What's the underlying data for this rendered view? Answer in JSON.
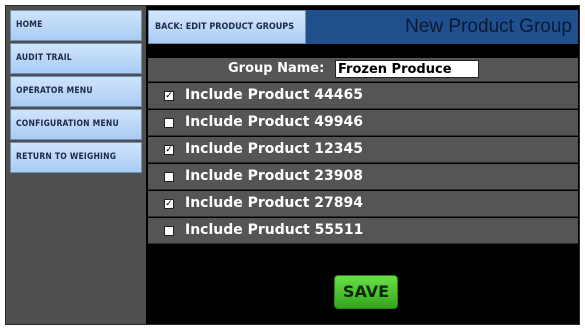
{
  "sidebar": {
    "items": [
      {
        "label": "HOME"
      },
      {
        "label": "AUDIT TRAIL"
      },
      {
        "label": "OPERATOR MENU"
      },
      {
        "label": "CONFIGURATION MENU"
      },
      {
        "label": "RETURN TO WEIGHING"
      }
    ]
  },
  "header": {
    "back_label": "BACK: EDIT PRODUCT GROUPS",
    "title": "New Product Group"
  },
  "group": {
    "label": "Group Name:",
    "value": "Frozen Produce"
  },
  "products": [
    {
      "label": "Include Product 44465",
      "checked": true,
      "mark": "✓"
    },
    {
      "label": "Include Product 49946",
      "checked": false,
      "mark": ""
    },
    {
      "label": "Include Product 12345",
      "checked": true,
      "mark": "✓"
    },
    {
      "label": "Include Product 23908",
      "checked": false,
      "mark": ""
    },
    {
      "label": "Include Product 27894",
      "checked": true,
      "mark": "✓"
    },
    {
      "label": "Include Pruduct 55511",
      "checked": false,
      "mark": ""
    }
  ],
  "actions": {
    "save_label": "SAVE"
  },
  "colors": {
    "nav_button": "#b7d6f8",
    "title_bar": "#1f4f8d",
    "row_bg": "#555555",
    "save_button": "#4cc12f"
  }
}
